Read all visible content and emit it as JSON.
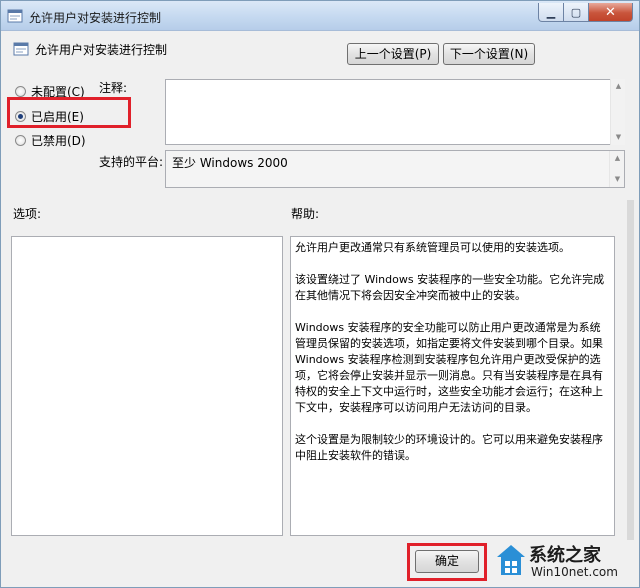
{
  "window": {
    "title": "允许用户对安装进行控制",
    "minimize_glyph": "▁",
    "maximize_glyph": "▢",
    "close_glyph": "✕"
  },
  "header": {
    "policy_title": "允许用户对安装进行控制",
    "prev_button": "上一个设置(P)",
    "next_button": "下一个设置(N)"
  },
  "state": {
    "options": [
      {
        "label": "未配置(C)",
        "checked": false
      },
      {
        "label": "已启用(E)",
        "checked": true
      },
      {
        "label": "已禁用(D)",
        "checked": false
      }
    ]
  },
  "comment": {
    "label": "注释:",
    "value": ""
  },
  "platform": {
    "label": "支持的平台:",
    "value": "至少 Windows 2000"
  },
  "options_panel": {
    "label": "选项:"
  },
  "help_panel": {
    "label": "帮助:",
    "paragraphs": [
      "允许用户更改通常只有系统管理员可以使用的安装选项。",
      "该设置绕过了 Windows 安装程序的一些安全功能。它允许完成在其他情况下将会因安全冲突而被中止的安装。",
      "Windows 安装程序的安全功能可以防止用户更改通常是为系统管理员保留的安装选项，如指定要将文件安装到哪个目录。如果 Windows 安装程序检测到安装程序包允许用户更改受保护的选项，它将会停止安装并显示一则消息。只有当安装程序是在具有特权的安全上下文中运行时，这些安全功能才会运行；在这种上下文中，安装程序可以访问用户无法访问的目录。",
      "这个设置是为限制较少的环境设计的。它可以用来避免安装程序中阻止安装软件的错误。"
    ]
  },
  "footer": {
    "ok_button": "确定"
  },
  "watermark": {
    "brand": "系统之家",
    "site": "Win10net.com"
  },
  "colors": {
    "highlight": "#e0202a",
    "titlebar": "#c5d9f0",
    "close": "#c9553c"
  }
}
